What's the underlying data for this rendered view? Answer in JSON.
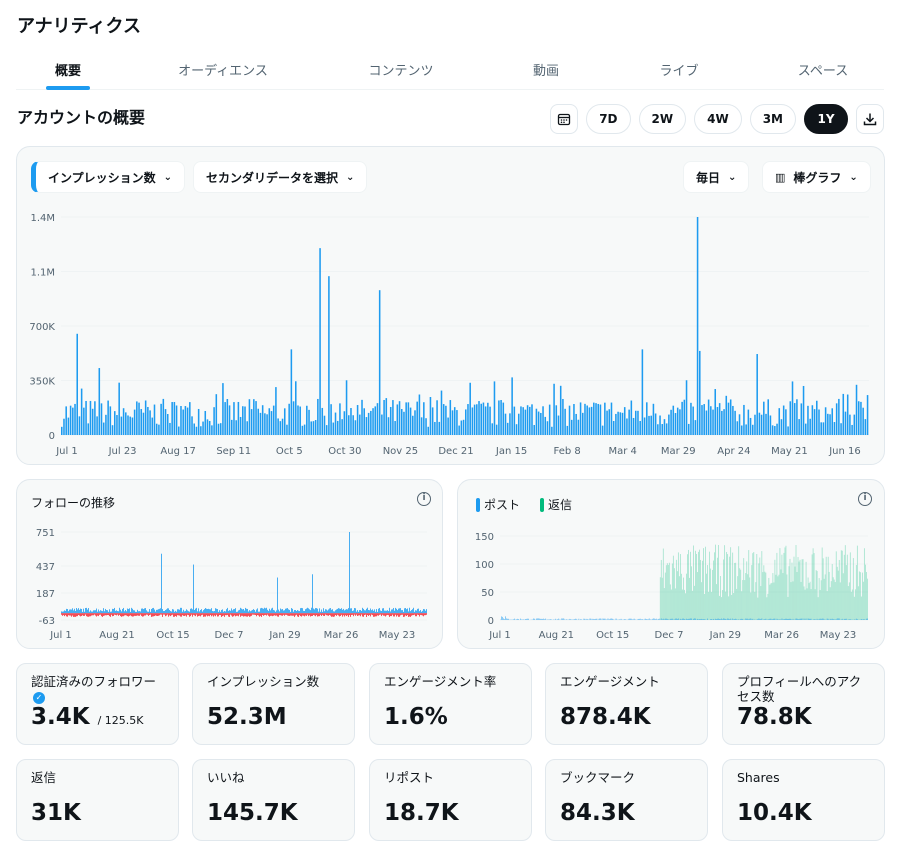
{
  "header": {
    "title": "アナリティクス"
  },
  "tabs": [
    {
      "label": "概要",
      "active": true
    },
    {
      "label": "オーディエンス"
    },
    {
      "label": "コンテンツ"
    },
    {
      "label": "動画"
    },
    {
      "label": "ライブ"
    },
    {
      "label": "スペース"
    }
  ],
  "overview": {
    "title": "アカウントの概要",
    "ranges": [
      "7D",
      "2W",
      "4W",
      "3M",
      "1Y"
    ],
    "active_range": "1Y"
  },
  "main_chart": {
    "metric_select": "インプレッション数",
    "secondary_select": "セカンダリデータを選択",
    "interval_select": "毎日",
    "chart_type_select": "棒グラフ"
  },
  "follow_chart": {
    "title": "フォローの推移"
  },
  "posts_chart": {
    "legend": [
      "ポスト",
      "返信"
    ]
  },
  "stats": [
    {
      "label": "認証済みのフォロワー",
      "value": "3.4K",
      "sub": "/ 125.5K"
    },
    {
      "label": "インプレッション数",
      "value": "52.3M"
    },
    {
      "label": "エンゲージメント率",
      "value": "1.6%"
    },
    {
      "label": "エンゲージメント",
      "value": "878.4K"
    },
    {
      "label": "プロフィールへのアクセス数",
      "value": "78.8K"
    },
    {
      "label": "返信",
      "value": "31K"
    },
    {
      "label": "いいね",
      "value": "145.7K"
    },
    {
      "label": "リポスト",
      "value": "18.7K"
    },
    {
      "label": "ブックマーク",
      "value": "84.3K"
    },
    {
      "label": "Shares",
      "value": "10.4K"
    }
  ],
  "colors": {
    "accent": "#1d9bf0",
    "reply": "#00ba7c",
    "negative": "#f4212e"
  },
  "chart_data": [
    {
      "type": "bar",
      "x_start": "2023-07-01",
      "x_ticks": [
        "Jul 1",
        "Jul 23",
        "Aug 17",
        "Sep 11",
        "Oct 5",
        "Oct 30",
        "Nov 25",
        "Dec 21",
        "Jan 15",
        "Feb 8",
        "Mar 4",
        "Mar 29",
        "Apr 24",
        "May 21",
        "Jun 16"
      ],
      "y_ticks": [
        "0",
        "350K",
        "700K",
        "1.1M",
        "1.4M"
      ],
      "ylim": [
        0,
        1400000
      ],
      "baseline": 150000,
      "peaks": [
        {
          "date": "2023-07-08",
          "value": 650000
        },
        {
          "date": "2023-07-18",
          "value": 430000
        },
        {
          "date": "2023-09-26",
          "value": 230000
        },
        {
          "date": "2023-10-13",
          "value": 550000
        },
        {
          "date": "2023-10-26",
          "value": 1200000
        },
        {
          "date": "2023-10-30",
          "value": 1020000
        },
        {
          "date": "2023-11-22",
          "value": 930000
        },
        {
          "date": "2023-12-10",
          "value": 260000
        },
        {
          "date": "2024-01-21",
          "value": 370000
        },
        {
          "date": "2024-03-20",
          "value": 550000
        },
        {
          "date": "2024-04-14",
          "value": 1400000
        },
        {
          "date": "2024-04-15",
          "value": 540000
        },
        {
          "date": "2024-05-11",
          "value": 520000
        },
        {
          "date": "2024-06-21",
          "value": 260000
        }
      ]
    },
    {
      "type": "bar",
      "x_ticks": [
        "Jul 1",
        "Aug 21",
        "Oct 15",
        "Dec 7",
        "Jan 29",
        "Mar 26",
        "May 23"
      ],
      "y_ticks": [
        "751",
        "437",
        "187",
        "-63"
      ],
      "ylim": [
        -63,
        751
      ],
      "baseline": 30,
      "negative_baseline": -25,
      "peaks": [
        {
          "date": "2023-10-09",
          "value": 550
        },
        {
          "date": "2023-11-10",
          "value": 450
        },
        {
          "date": "2024-02-02",
          "value": 330
        },
        {
          "date": "2024-03-08",
          "value": 360
        },
        {
          "date": "2024-04-14",
          "value": 751
        }
      ]
    },
    {
      "type": "bar",
      "x_ticks": [
        "Jul 1",
        "Aug 21",
        "Oct 15",
        "Dec 7",
        "Jan 29",
        "Mar 26",
        "May 23"
      ],
      "y_ticks": [
        "150",
        "100",
        "50",
        "0"
      ],
      "ylim": [
        0,
        150
      ],
      "series": [
        {
          "name": "ポスト",
          "baseline": 2
        },
        {
          "name": "返信",
          "start": "2023-12-07",
          "range": [
            40,
            135
          ]
        }
      ]
    }
  ]
}
